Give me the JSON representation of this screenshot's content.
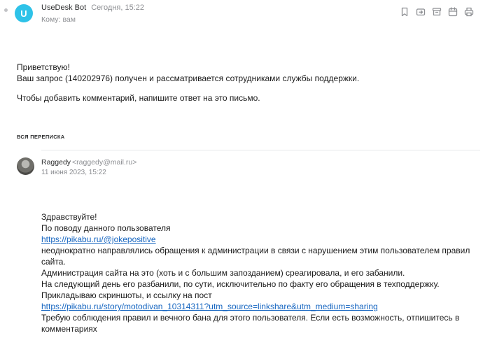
{
  "header": {
    "avatar_letter": "U",
    "sender_name": "UseDesk Bot",
    "date": "Сегодня, 15:22",
    "to_label": "Кому:",
    "to_value": "вам"
  },
  "toolbar": {
    "icons": [
      "bookmark-icon",
      "forward-icon",
      "archive-icon",
      "calendar-icon",
      "print-icon"
    ]
  },
  "message": {
    "line1": "Приветствую!",
    "line2": "Ваш запрос (140202976) получен и рассматривается сотрудниками службы поддержки.",
    "line3": "Чтобы добавить комментарий, напишите ответ на это письмо."
  },
  "thread": {
    "label": "ВСЯ ПЕРЕПИСКА"
  },
  "quoted": {
    "sender_name": "Raggedy",
    "sender_email": "<raggedy@mail.ru>",
    "date": "11 июня 2023, 15:22",
    "lines": {
      "l1": "Здравствуйте!",
      "l2": "По поводу данного пользователя",
      "link1": "https://pikabu.ru/@jokepositive",
      "l3": "неоднократно направлялись обращения к администрации в связи с нарушением этим пользователем правил сайта.",
      "l4": "Администрация сайта на это (хоть и с большим запозданием) среагировала, и его забанили.",
      "l5": "На следующий день его разбанили, по сути, исключительно по факту его обращения в техподдержку.",
      "l6": "Прикладываю скриншоты, и ссылку на пост",
      "link2": "https://pikabu.ru/story/motodivan_10314311?utm_source=linkshare&utm_medium=sharing",
      "l7": "Требую соблюдения правил и вечного бана для этого пользователя. Если есть возможность, отпишитесь в комментариях"
    }
  }
}
